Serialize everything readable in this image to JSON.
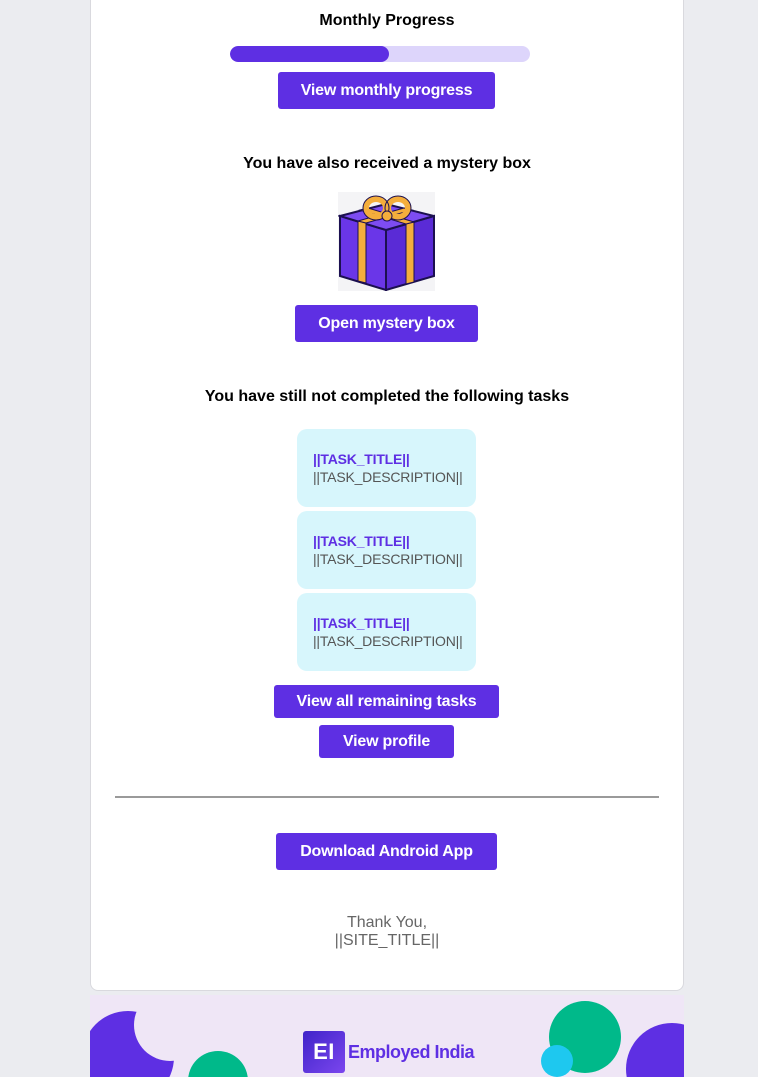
{
  "progress": {
    "heading": "Monthly Progress",
    "fill_fraction": 0.53,
    "button_label": "View monthly progress"
  },
  "mystery": {
    "heading": "You have also received a mystery box",
    "icon": "gift-box-icon",
    "button_label": "Open mystery box"
  },
  "tasks": {
    "heading": "You have still not completed the following tasks",
    "items": [
      {
        "title": "||TASK_TITLE||",
        "description": "||TASK_DESCRIPTION||"
      },
      {
        "title": "||TASK_TITLE||",
        "description": "||TASK_DESCRIPTION||"
      },
      {
        "title": "||TASK_TITLE||",
        "description": "||TASK_DESCRIPTION||"
      }
    ],
    "view_all_label": "View all remaining tasks",
    "view_profile_label": "View profile"
  },
  "app": {
    "download_label": "Download Android App"
  },
  "signoff": {
    "line1": "Thank You,",
    "line2": "||SITE_TITLE||"
  },
  "footer": {
    "logo_mark": "EI",
    "logo_text": "Employed India"
  },
  "colors": {
    "accent": "#5e2fe3",
    "progress_track": "#ddd5fb",
    "task_card": "#d7f6fc",
    "footer_bg": "#efe6f6",
    "gift_ribbon": "#f4ae3c",
    "decor_green": "#00b98a",
    "decor_cyan": "#1ec8ef"
  }
}
